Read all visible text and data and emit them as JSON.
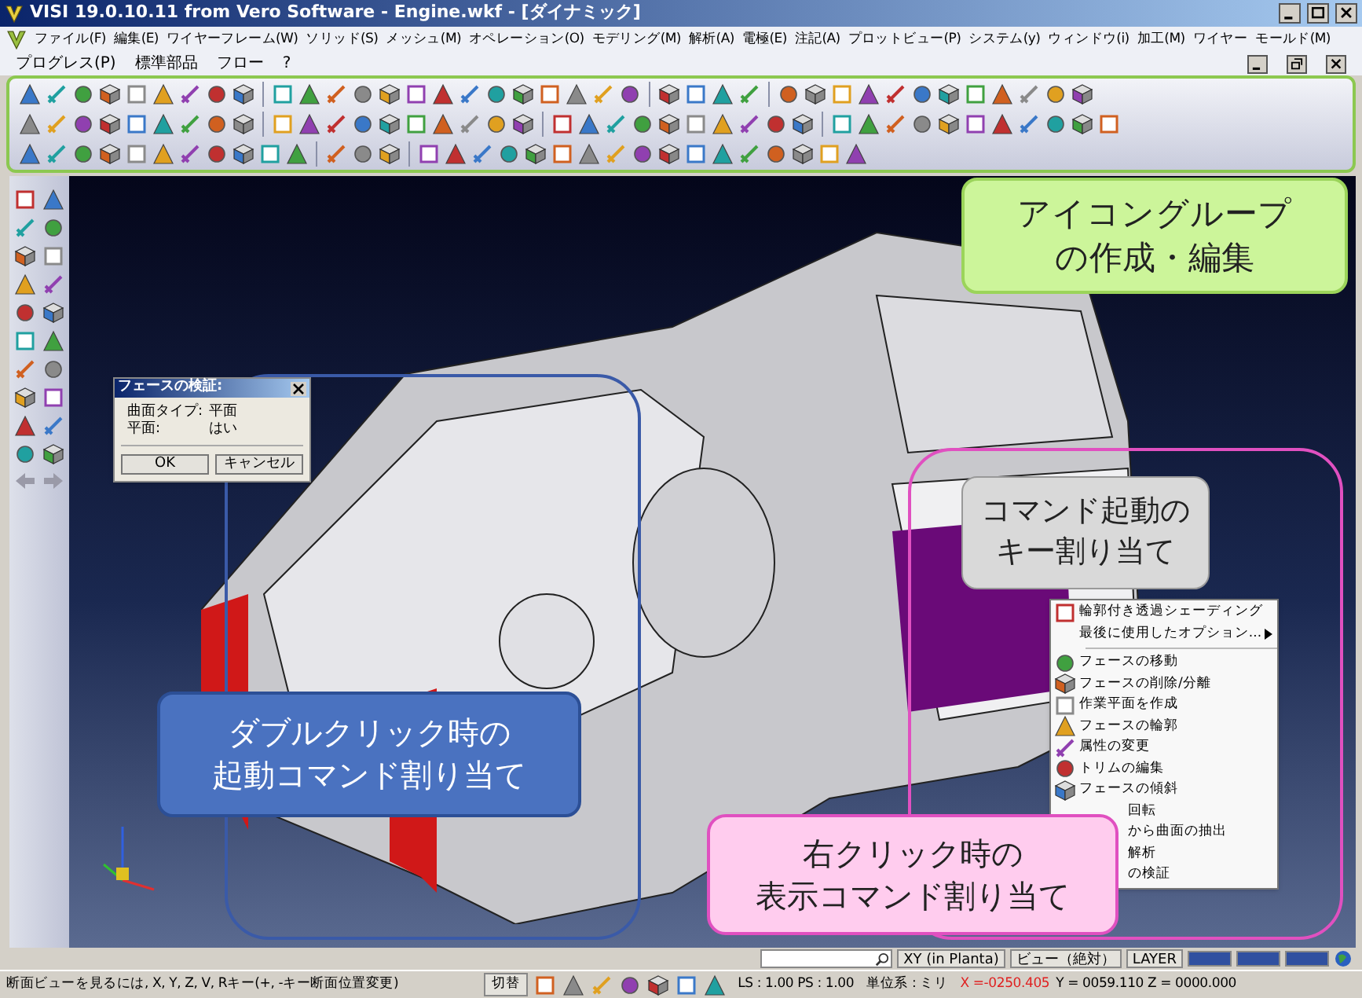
{
  "window": {
    "title": "VISI 19.0.10.11 from Vero Software - Engine.wkf - [ダイナミック]"
  },
  "menu_bar": {
    "items": [
      "ファイル(F)",
      "編集(E)",
      "ワイヤーフレーム(W)",
      "ソリッド(S)",
      "メッシュ(M)",
      "オペレーション(O)",
      "モデリング(M)",
      "解析(A)",
      "電極(E)",
      "注記(A)",
      "プロットビュー(P)",
      "システム(y)",
      "ウィンドウ(i)",
      "加工(M)",
      "ワイヤー",
      "モールド(M)"
    ],
    "items_row2": [
      "プログレス(P)",
      "標準部品",
      "フロー",
      "?"
    ]
  },
  "dialog": {
    "title": "フェースの検証:",
    "rows": [
      {
        "label": "曲面タイプ:",
        "value": "平面"
      },
      {
        "label": "平面:",
        "value": "はい"
      }
    ],
    "buttons": [
      "OK",
      "キャンセル"
    ]
  },
  "context_menu": {
    "items": [
      {
        "kind": "item",
        "label": "輪郭付き透過シェーディング",
        "covered": false
      },
      {
        "kind": "submenu",
        "label": "最後に使用したオプション...",
        "covered": false
      },
      {
        "kind": "separator"
      },
      {
        "kind": "item",
        "label": "フェースの移動",
        "covered": false
      },
      {
        "kind": "item",
        "label": "フェースの削除/分離",
        "covered": false
      },
      {
        "kind": "item",
        "label": "作業平面を作成",
        "covered": false
      },
      {
        "kind": "item",
        "label": "フェースの輪郭",
        "covered": false
      },
      {
        "kind": "item",
        "label": "属性の変更",
        "covered": false
      },
      {
        "kind": "item",
        "label": "トリムの編集",
        "covered": false
      },
      {
        "kind": "item",
        "label": "フェースの傾斜",
        "covered": false
      },
      {
        "kind": "item",
        "label": "回転",
        "covered": true
      },
      {
        "kind": "item",
        "label": "から曲面の抽出",
        "covered": true
      },
      {
        "kind": "item",
        "label": "解析",
        "covered": true
      },
      {
        "kind": "item",
        "label": "の検証",
        "covered": true
      }
    ]
  },
  "callouts": [
    {
      "kind": "green",
      "lines": [
        "アイコングループ",
        "の作成・編集"
      ]
    },
    {
      "kind": "gray",
      "lines": [
        "コマンド起動の",
        "キー割り当て"
      ]
    },
    {
      "kind": "blue",
      "lines": [
        "ダブルクリック時の",
        "起動コマンド割り当て"
      ]
    },
    {
      "kind": "pink",
      "lines": [
        "右クリック時の",
        "表示コマンド割り当て"
      ]
    }
  ],
  "status_bar": {
    "view_buttons": [
      "XY (in Planta)",
      "ビュー（絶対）",
      "LAYER"
    ],
    "message": "断面ビューを見るには, X, Y, Z, V, Rキー(+, -キー断面位置変更)",
    "switch": "切替",
    "scale": "LS : 1.00 PS : 1.00",
    "units": "単位系 : ミリ",
    "x": "X =-0250.405",
    "yz": "Y = 0059.110 Z = 0000.000"
  }
}
